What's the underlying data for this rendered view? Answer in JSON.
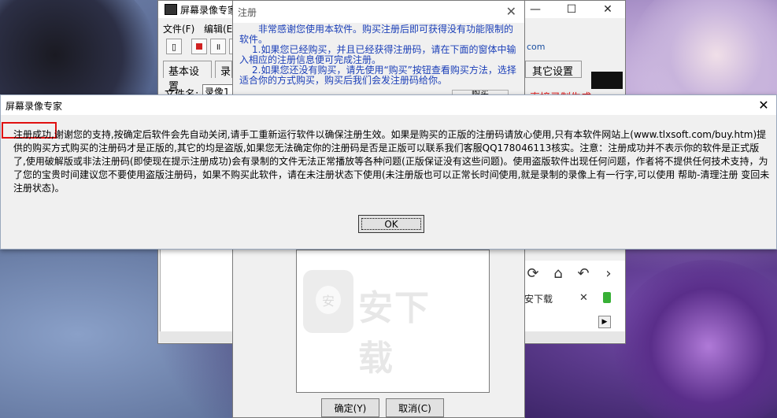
{
  "app_window": {
    "title": "屏幕录像专家",
    "menus": [
      "文件(F)",
      "编辑(E)"
    ],
    "tabs": [
      "基本设置",
      "录"
    ],
    "right_tab": "其它设置",
    "filename_label": "文件名:",
    "filename_value": "录像1",
    "url_fragment": "com",
    "red_link": "直接录制生成",
    "buy_button": "购买",
    "browser_tab": "安下载",
    "browser_tab_close": "✕"
  },
  "reg_window": {
    "title": "注册",
    "intro": [
      "非常感谢您使用本软件。购买注册后即可获得没有功能限制的软件。",
      "1.如果您已经购买，并且已经获得注册码，请在下面的窗体中输入相应的注册信息便可完成注册。",
      "2.如果您还没有购买，请先使用“购买”按钮查看购买方法，选择适合你的方式购买，购买后我们会发注册码给你。"
    ],
    "confirm_button": "确定(Y)",
    "cancel_button": "取消(C)"
  },
  "message_box": {
    "title": "屏幕录像专家",
    "close_glyph": "✕",
    "body": "注册成功,谢谢您的支持,按确定后软件会先自动关闭,请手工重新运行软件以确保注册生效。如果是购买的正版的注册码请放心使用,只有本软件网站上(www.tlxsoft.com/buy.htm)提供的购买方式购买的注册码才是正版的,其它的均是盗版,如果您无法确定你的注册码是否是正版可以联系我们客服QQ178046113核实。注意：注册成功并不表示你的软件是正式版了,使用破解版或非法注册码(即使现在提示注册成功)会有录制的文件无法正常播放等各种问题(正版保证没有这些问题)。使用盗版软件出现任何问题，作者将不提供任何技术支持，为了您的宝贵时间建议您不要使用盗版注册码，如果不购买此软件，请在未注册状态下使用(未注册版也可以正常长时间使用,就是录制的录像上有一行字,可以使用 帮助-清理注册 变回未注册状态)。",
    "ok_button": "OK"
  },
  "watermark": {
    "text": "安下载",
    "shield_glyph": "安"
  },
  "colors": {
    "intro_text": "#1b3fb8",
    "highlight": "#e01010",
    "link_red": "#e02020"
  }
}
